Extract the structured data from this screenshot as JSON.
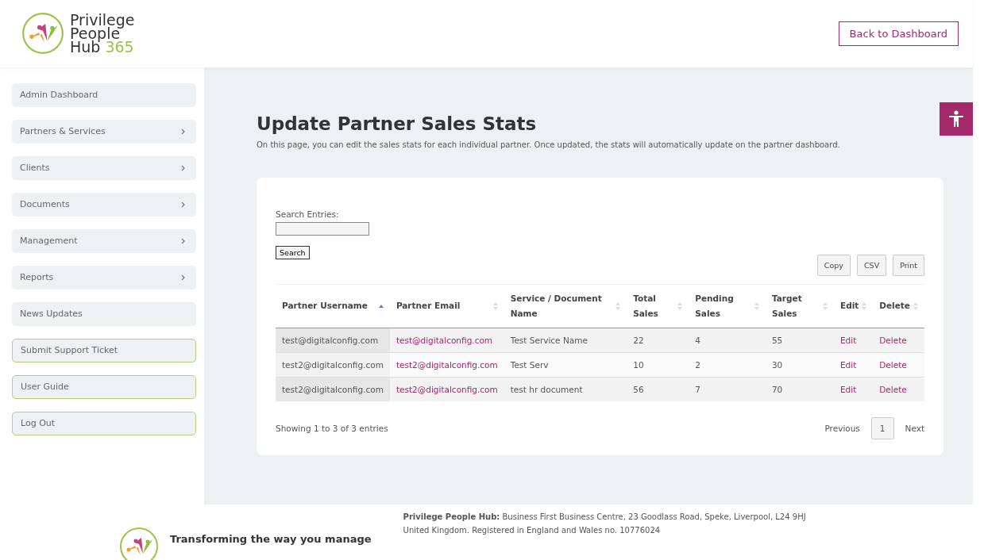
{
  "header": {
    "logo_text": [
      "Privilege",
      "People",
      "Hub"
    ],
    "logo_number": "365",
    "back_button": "Back to Dashboard"
  },
  "sidebar": {
    "items": [
      {
        "label": "Admin Dashboard",
        "kind": "menu",
        "has_submenu": false
      },
      {
        "label": "Partners & Services",
        "kind": "menu",
        "has_submenu": true
      },
      {
        "label": "Clients",
        "kind": "menu",
        "has_submenu": true
      },
      {
        "label": "Documents",
        "kind": "menu",
        "has_submenu": true
      },
      {
        "label": "Management",
        "kind": "menu",
        "has_submenu": true
      },
      {
        "label": "Reports",
        "kind": "menu",
        "has_submenu": true
      },
      {
        "label": "News Updates",
        "kind": "menu",
        "has_submenu": false
      },
      {
        "label": "Submit Support Ticket",
        "kind": "action",
        "has_submenu": false
      },
      {
        "label": "User Guide",
        "kind": "action",
        "has_submenu": false
      },
      {
        "label": "Log Out",
        "kind": "action",
        "has_submenu": false
      }
    ]
  },
  "page": {
    "title": "Update Partner Sales Stats",
    "description": "On this page, you can edit the sales stats for each individual partner. Once updated, the stats will automatically update on the partner dashboard."
  },
  "search": {
    "label": "Search Entries:",
    "button": "Search"
  },
  "export_buttons": [
    "Copy",
    "CSV",
    "Print"
  ],
  "table": {
    "columns": [
      {
        "label": "Partner Username",
        "sorted": true
      },
      {
        "label": "Partner Email",
        "sorted": false
      },
      {
        "label": "Service / Document Name",
        "sorted": false
      },
      {
        "label": "Total Sales",
        "sorted": false
      },
      {
        "label": "Pending Sales",
        "sorted": false
      },
      {
        "label": "Target Sales",
        "sorted": false
      },
      {
        "label": "Edit",
        "sorted": false
      },
      {
        "label": "Delete",
        "sorted": false
      }
    ],
    "rows": [
      [
        "test@digitalconfig.com",
        "test@digitalconfig.com",
        "Test Service Name",
        "22",
        "4",
        "55",
        "Edit",
        "Delete"
      ],
      [
        "test2@digitalconfig.com",
        "test2@digitalconfig.com",
        "Test Serv",
        "10",
        "2",
        "30",
        "Edit",
        "Delete"
      ],
      [
        "test2@digitalconfig.com",
        "test2@digitalconfig.com",
        "test hr document",
        "56",
        "7",
        "70",
        "Edit",
        "Delete"
      ]
    ]
  },
  "table_info": "Showing 1 to 3 of 3 entries",
  "pagination": {
    "previous": "Previous",
    "pages": [
      {
        "label": "1",
        "selected": true
      }
    ],
    "next": "Next"
  },
  "footer": {
    "tagline": "Transforming the way you manage",
    "address_label": "Privilege People Hub:",
    "address": "Business First Business Centre, 23 Goodlass Road, Speke, Liverpool, L24 9HJ",
    "registration": "United Kingdom. Registered in England and Wales no. 10776024"
  }
}
